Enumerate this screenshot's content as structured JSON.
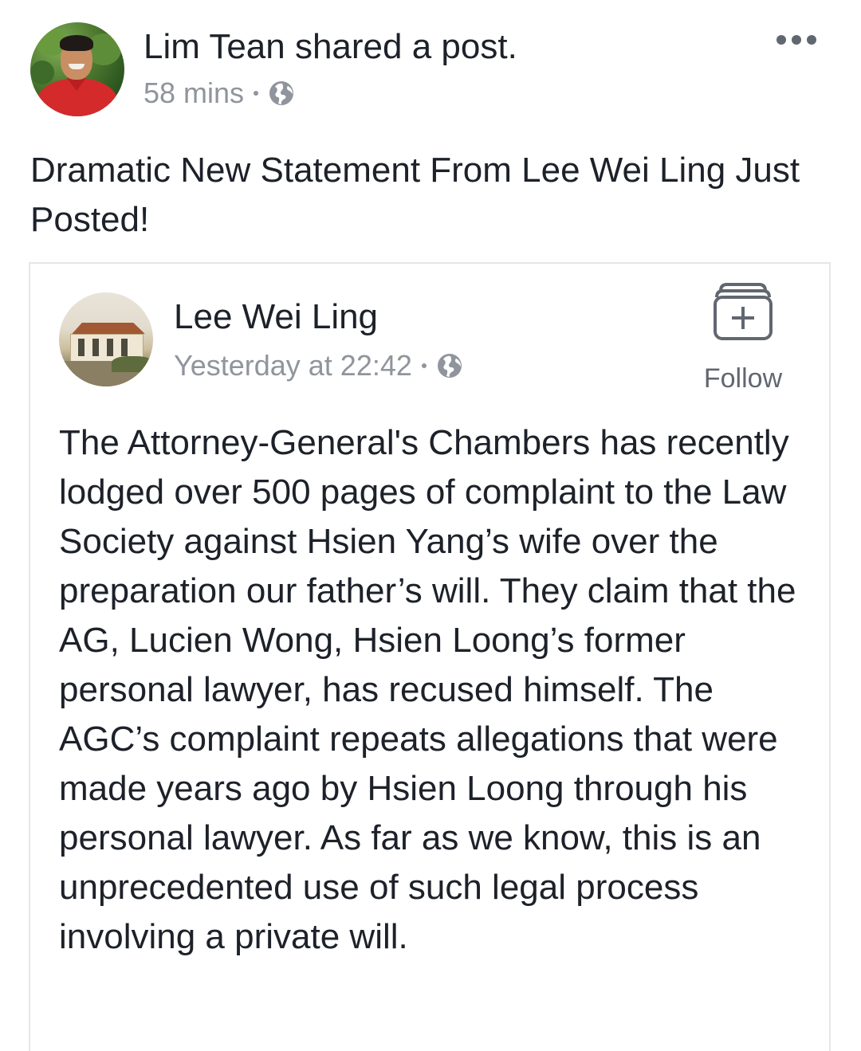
{
  "post": {
    "author_line": "Lim Tean shared a post.",
    "time": "58 mins",
    "privacy_icon": "globe-icon",
    "more_icon": "more-options-icon",
    "text": "Dramatic New Statement From Lee Wei Ling Just Posted!"
  },
  "shared": {
    "author": "Lee Wei Ling",
    "time": "Yesterday at 22:42",
    "privacy_icon": "globe-icon",
    "follow_label": "Follow",
    "follow_icon": "follow-plus-icon",
    "body": "The Attorney-General's Chambers has recently lodged over 500 pages of complaint to the Law Society against Hsien Yang’s wife over the preparation our father’s will.  They claim that the AG, Lucien Wong, Hsien Loong’s former personal lawyer, has recused himself.  The AGC’s complaint repeats allegations that were made years ago by Hsien Loong through his personal lawyer.  As far as we know, this is an unprecedented use of such legal process involving a private will."
  },
  "colors": {
    "text_primary": "#1d2129",
    "text_secondary": "#90949c",
    "icon_gray": "#616770",
    "card_border": "#e5e6e9"
  }
}
